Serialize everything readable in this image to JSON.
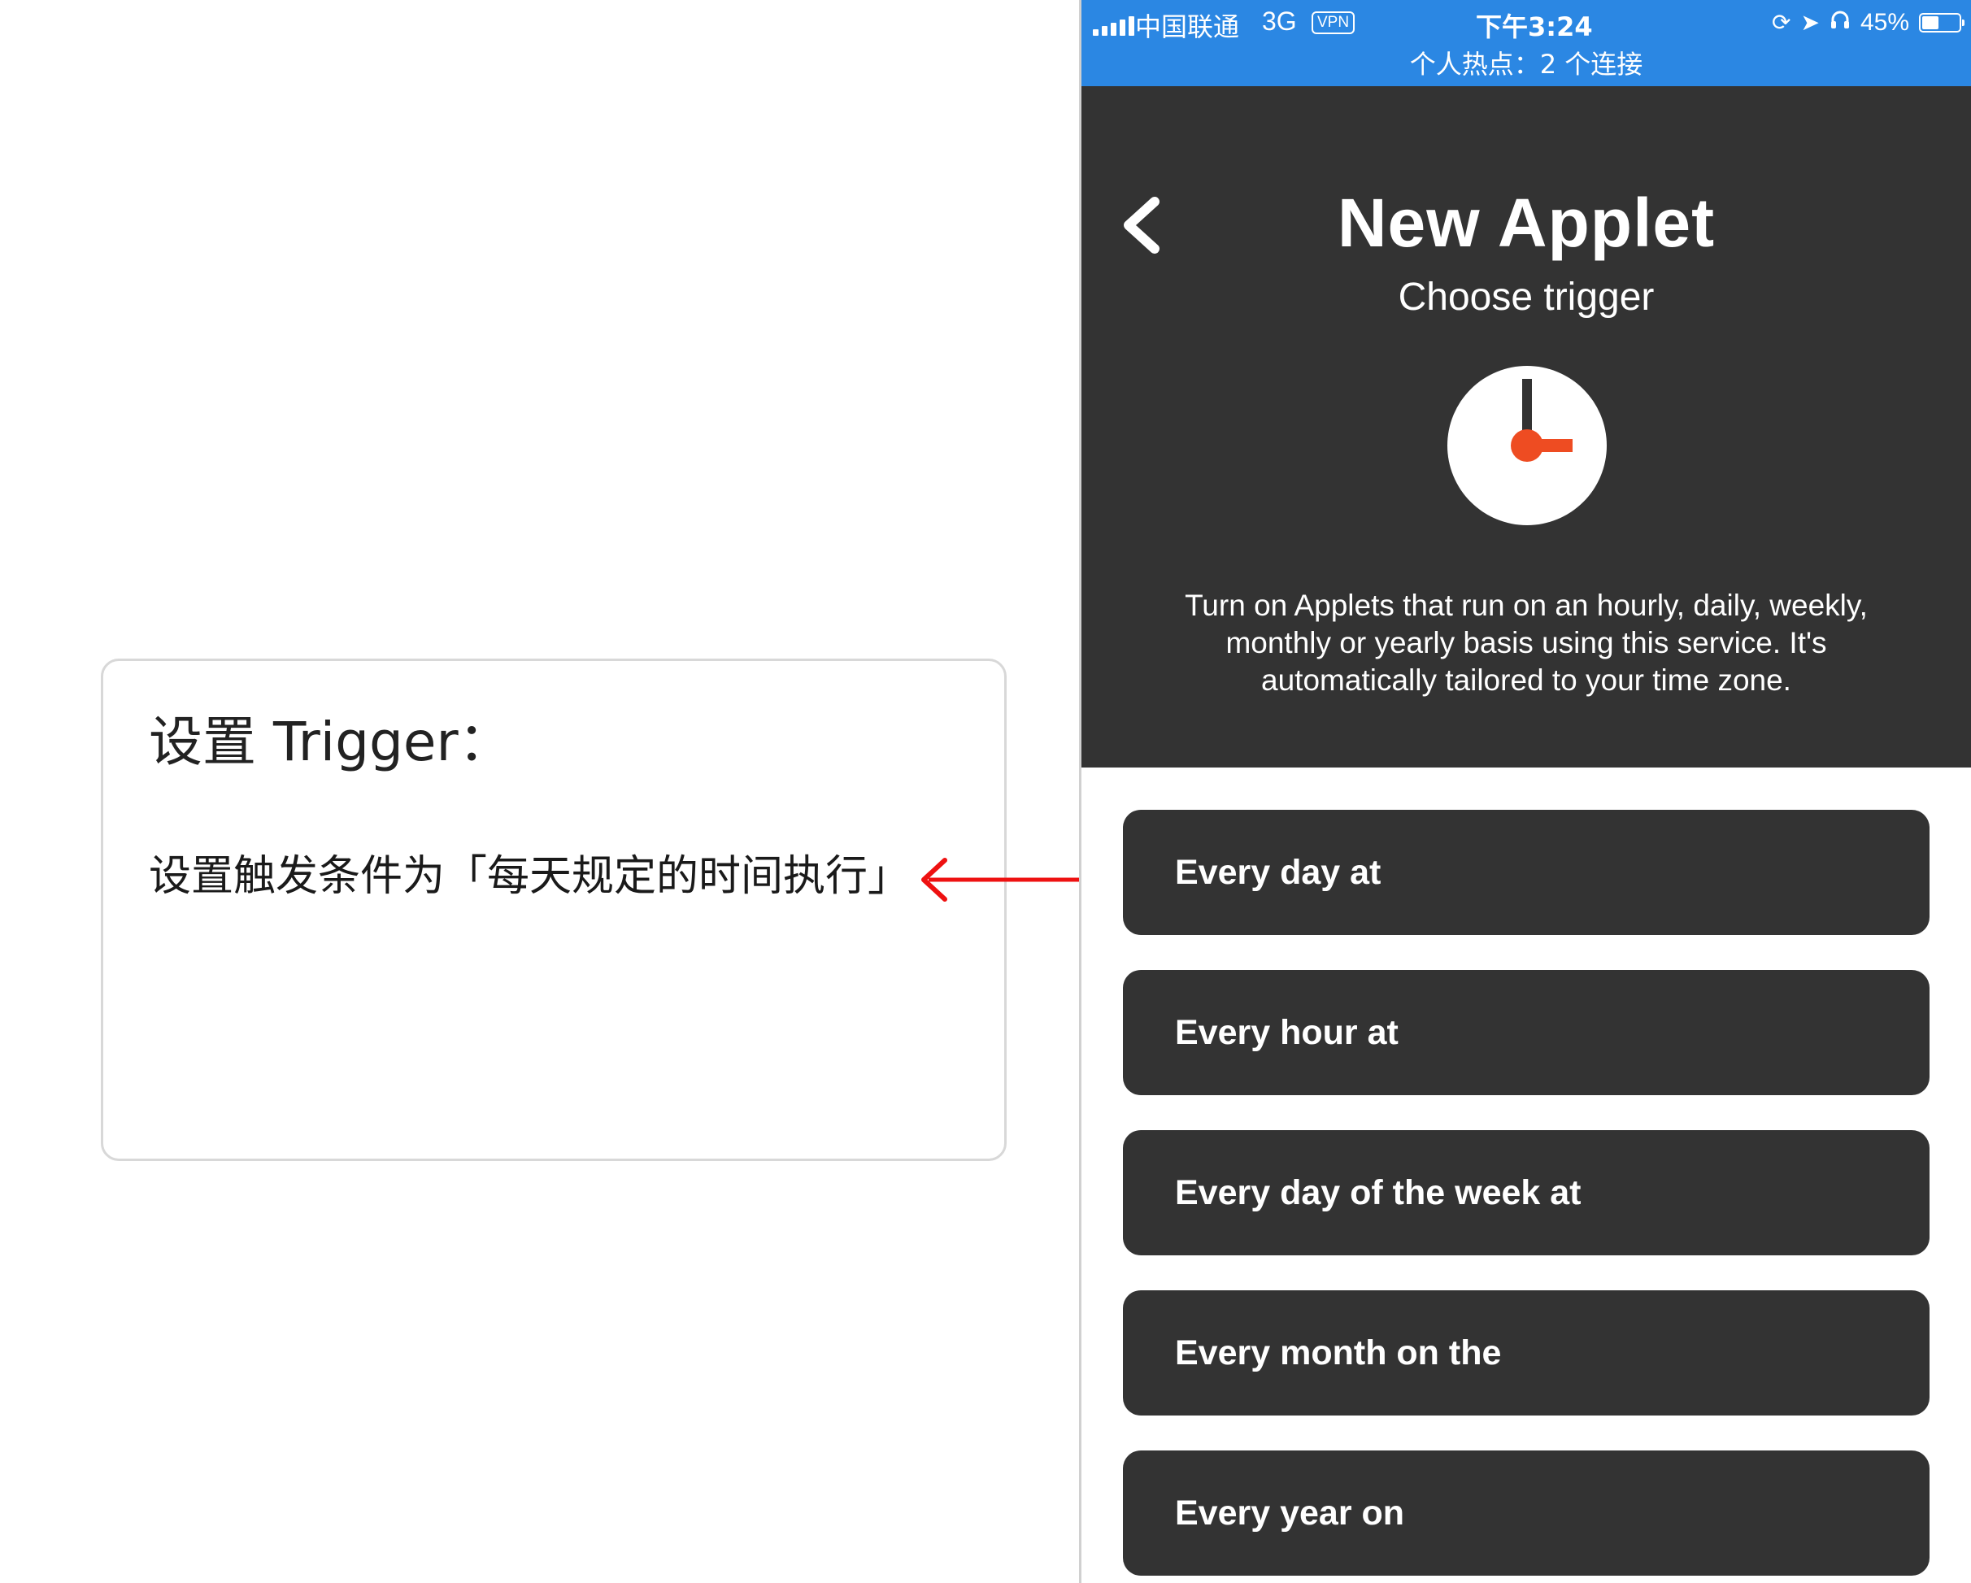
{
  "annotation": {
    "title": "设置 Trigger：",
    "body": "设置触发条件为「每天规定的时间执行」",
    "arrow_color": "#ee1111"
  },
  "status_bar": {
    "carrier": "中国联通",
    "network": "3G",
    "vpn": "VPN",
    "time": "下午3:24",
    "battery": "45%",
    "battery_level": 0.45,
    "hotspot": "个人热点：2 个连接",
    "background_color": "#2b87e3"
  },
  "header": {
    "title": "New Applet",
    "subtitle": "Choose trigger",
    "description": "Turn on Applets that run on an hourly, daily, weekly, monthly or yearly basis using this service. It's automatically tailored to your time zone.",
    "service_icon": "clock-icon",
    "icon_accent_color": "#ee4c22",
    "background_color": "#333333"
  },
  "triggers": [
    {
      "label": "Every day at"
    },
    {
      "label": "Every hour at"
    },
    {
      "label": "Every day of the week at"
    },
    {
      "label": "Every month on the"
    },
    {
      "label": "Every year on"
    }
  ]
}
